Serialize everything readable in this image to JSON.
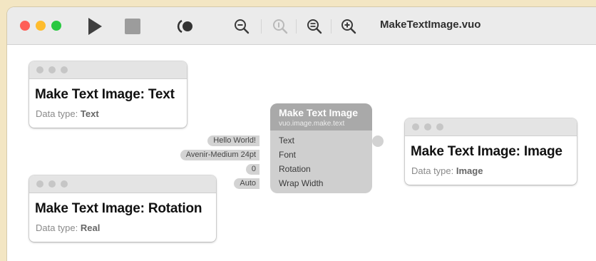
{
  "window": {
    "title": "MakeTextImage.vuo"
  },
  "colors": {
    "close": "#fe5f57",
    "minimize": "#febc2e",
    "zoom": "#28c840",
    "background": "#f3e6c3",
    "node_header": "#a9a9a9",
    "node_body": "#cfcfcf"
  },
  "toolbar": {
    "icons": [
      "play-icon",
      "stop-icon",
      "show-events-icon",
      "zoom-out-icon",
      "zoom-actual-icon",
      "zoom-to-fit-icon",
      "zoom-in-icon"
    ]
  },
  "node": {
    "title": "Make Text Image",
    "class_name": "vuo.image.make.text",
    "ports": [
      {
        "label": "Text",
        "constant": "Hello World!"
      },
      {
        "label": "Font",
        "constant": "Avenir-Medium 24pt"
      },
      {
        "label": "Rotation",
        "constant": "0"
      },
      {
        "label": "Wrap Width",
        "constant": "Auto"
      }
    ]
  },
  "published_windows": [
    {
      "title": "Make Text Image: Text",
      "type_label": "Data type:",
      "type_value": "Text"
    },
    {
      "title": "Make Text Image: Rotation",
      "type_label": "Data type:",
      "type_value": "Real"
    },
    {
      "title": "Make Text Image: Image",
      "type_label": "Data type:",
      "type_value": "Image"
    }
  ]
}
